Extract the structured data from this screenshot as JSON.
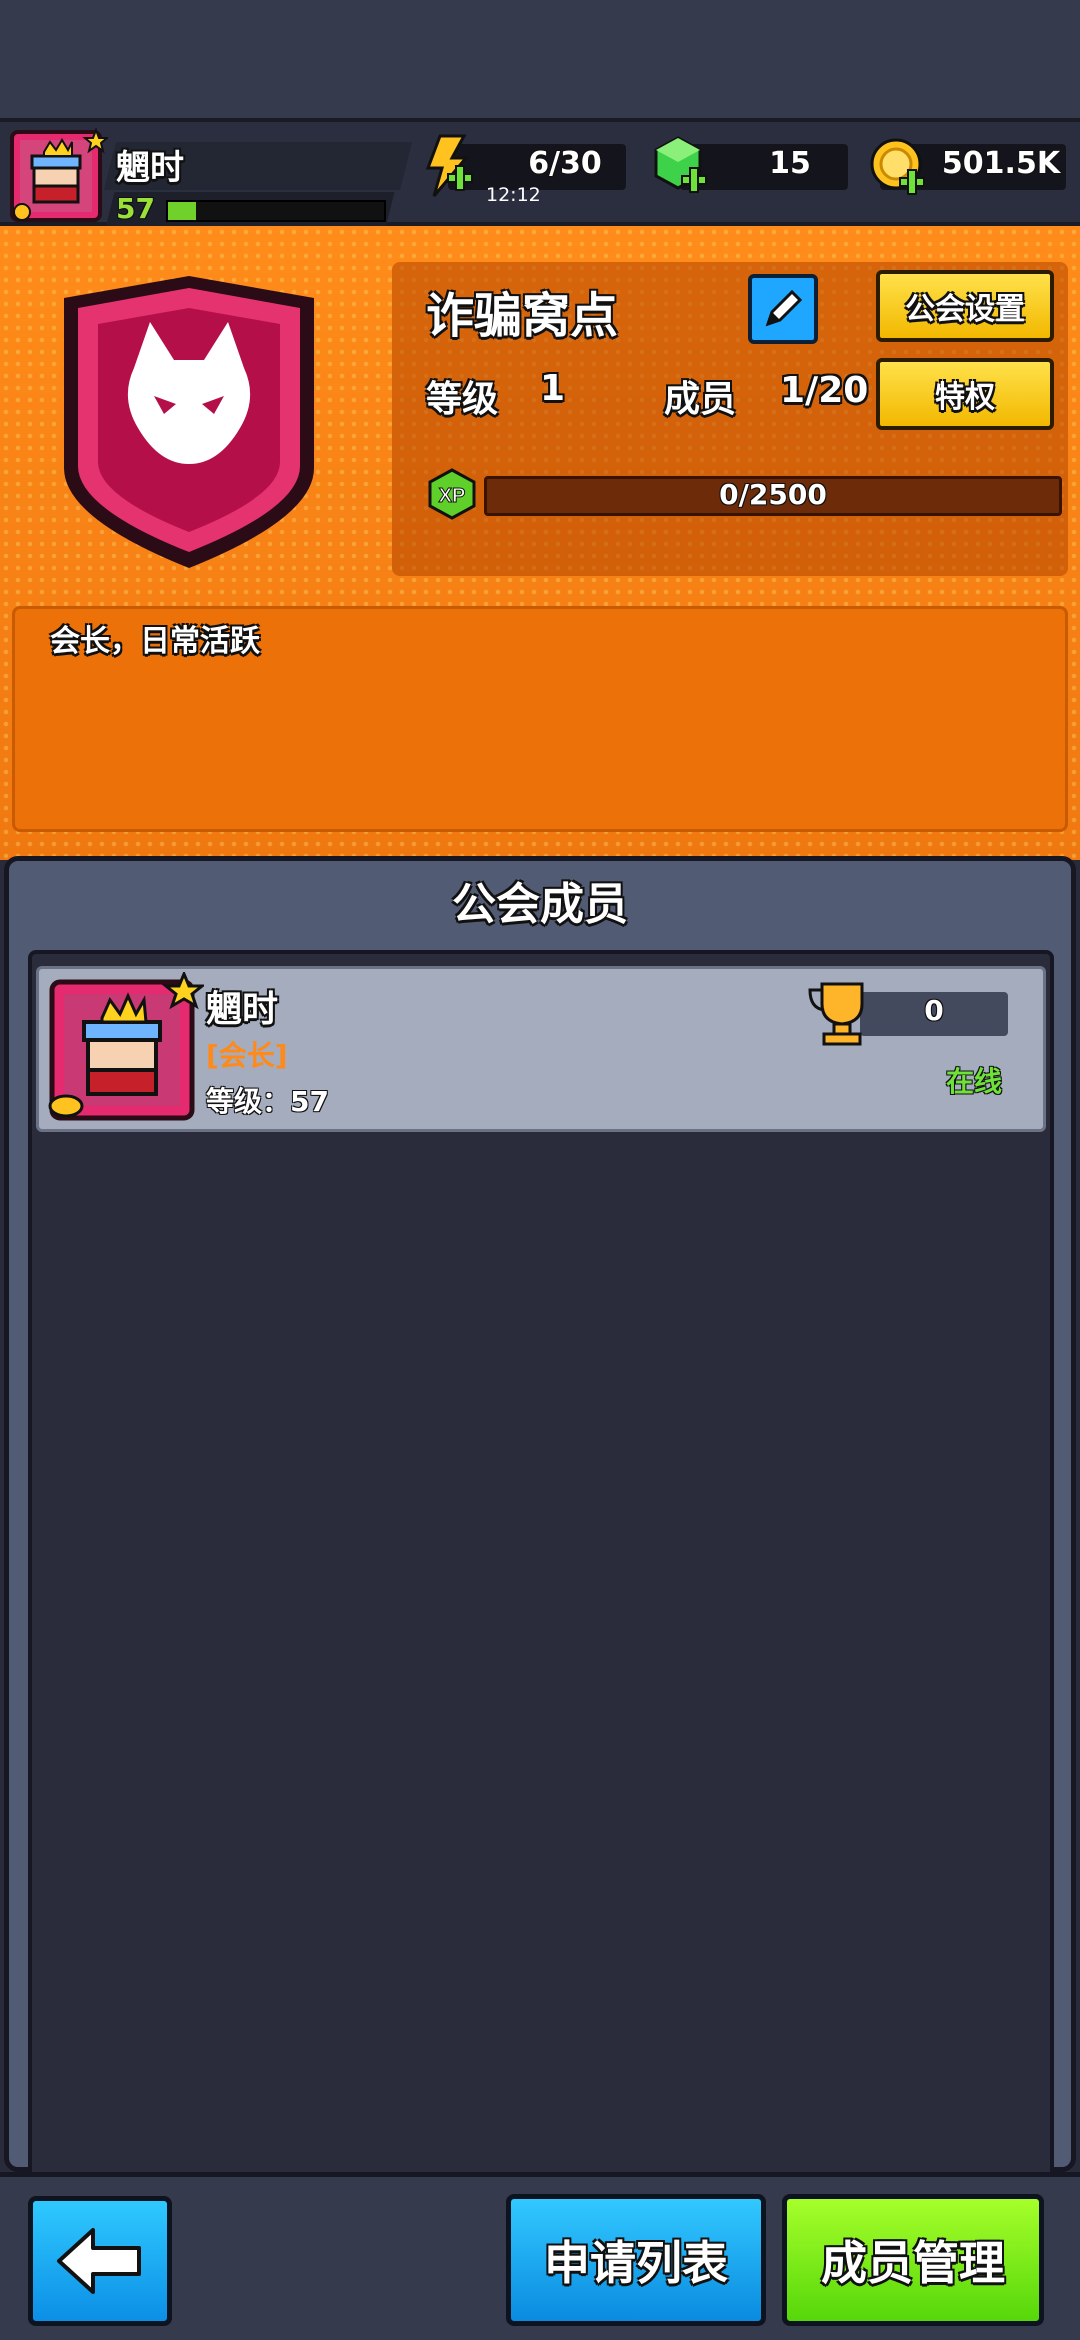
{
  "player": {
    "name": "魍时",
    "level": "57",
    "level_progress": 0.13
  },
  "resources": {
    "energy": "6/30",
    "energy_timer": "12:12",
    "gems": "15",
    "coins": "501.5K"
  },
  "guild": {
    "name": "诈骗窝点",
    "settings_label": "公会设置",
    "level_label": "等级",
    "level_value": "1",
    "members_label": "成员",
    "members_value": "1/20",
    "perks_label": "特权",
    "xp_badge": "XP",
    "xp_text": "0/2500",
    "xp_progress": 0.0,
    "description": "会长，日常活跃"
  },
  "members_section": {
    "title": "公会成员",
    "members": [
      {
        "name": "魍时",
        "role": "[会长]",
        "level": "等级：57",
        "trophies": "0",
        "status": "在线"
      }
    ]
  },
  "bottom": {
    "apply_list_label": "申请列表",
    "member_manage_label": "成员管理"
  },
  "icons": {
    "energy": "lightning-icon",
    "gems": "gem-icon",
    "coins": "coin-icon",
    "edit": "pencil-icon",
    "trophy": "trophy-icon",
    "back": "arrow-left-icon",
    "emblem": "cat-shield-emblem"
  },
  "colors": {
    "accent_orange": "#f07810",
    "button_yellow": "#f2b800",
    "button_blue": "#0a8be0",
    "button_green": "#56d70a",
    "online_green": "#6fe23a",
    "role_orange": "#ff8a1a"
  }
}
